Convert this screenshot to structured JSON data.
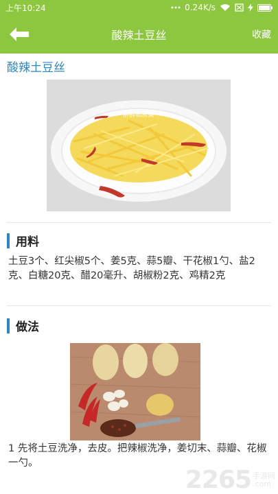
{
  "status_bar": {
    "time": "上午10:24",
    "network_speed": "0.24K/s"
  },
  "app_bar": {
    "title": "酸辣土豆丝",
    "favorite_label": "收藏"
  },
  "recipe": {
    "title": "酸辣土豆丝",
    "image_watermark": "胖胖私房菜"
  },
  "ingredients": {
    "heading": "用料",
    "text": "土豆3个、红尖椒5个、姜5克、蒜5瓣、干花椒1勺、盐2克、白糖20克、醋20毫升、胡椒粉2克、鸡精2克"
  },
  "method": {
    "heading": "做法",
    "steps": [
      "1 先将土豆洗净，去皮。把辣椒洗净，姜切末、蒜瓣、花椒一勺。"
    ]
  },
  "watermark": {
    "number": "2265",
    "suffix": ".com",
    "label": "手游网"
  },
  "colors": {
    "accent": "#8dc63f",
    "title_blue": "#2e86c1"
  }
}
